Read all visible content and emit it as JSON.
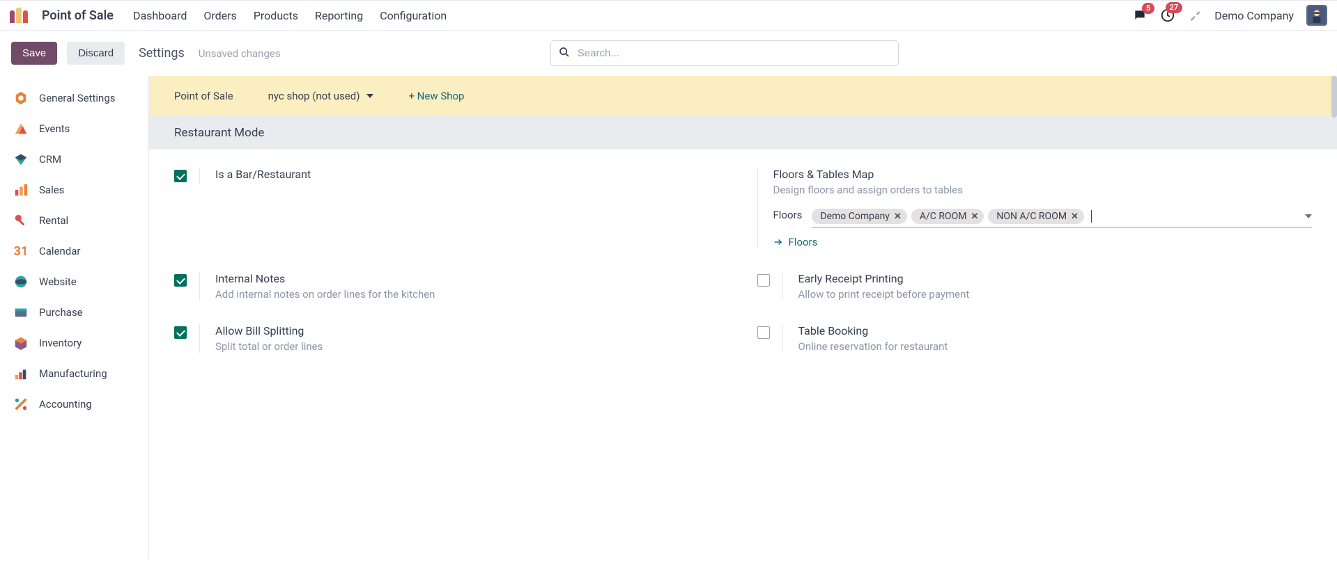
{
  "app_title": "Point of Sale",
  "nav": [
    "Dashboard",
    "Orders",
    "Products",
    "Reporting",
    "Configuration"
  ],
  "badges": {
    "chat": "5",
    "clock": "27"
  },
  "company": "Demo Company",
  "actions": {
    "save": "Save",
    "discard": "Discard"
  },
  "page_title": "Settings",
  "unsaved": "Unsaved changes",
  "search_placeholder": "Search...",
  "sidebar": [
    {
      "label": "General Settings"
    },
    {
      "label": "Events"
    },
    {
      "label": "CRM"
    },
    {
      "label": "Sales"
    },
    {
      "label": "Rental"
    },
    {
      "label": "Calendar"
    },
    {
      "label": "Website"
    },
    {
      "label": "Purchase"
    },
    {
      "label": "Inventory"
    },
    {
      "label": "Manufacturing"
    },
    {
      "label": "Accounting"
    }
  ],
  "pos_header": {
    "label": "Point of Sale",
    "selected": "nyc shop (not used)",
    "new": "+ New Shop"
  },
  "section": "Restaurant Mode",
  "settings": {
    "bar_restaurant": {
      "title": "Is a Bar/Restaurant"
    },
    "floors_map": {
      "title": "Floors & Tables Map",
      "desc": "Design floors and assign orders to tables"
    },
    "floors_label": "Floors",
    "floor_tags": [
      "Demo Company",
      "A/C ROOM",
      "NON A/C ROOM"
    ],
    "floors_link": "Floors",
    "internal_notes": {
      "title": "Internal Notes",
      "desc": "Add internal notes on order lines for the kitchen"
    },
    "early_receipt": {
      "title": "Early Receipt Printing",
      "desc": "Allow to print receipt before payment"
    },
    "bill_split": {
      "title": "Allow Bill Splitting",
      "desc": "Split total or order lines"
    },
    "table_booking": {
      "title": "Table Booking",
      "desc": "Online reservation for restaurant"
    }
  }
}
